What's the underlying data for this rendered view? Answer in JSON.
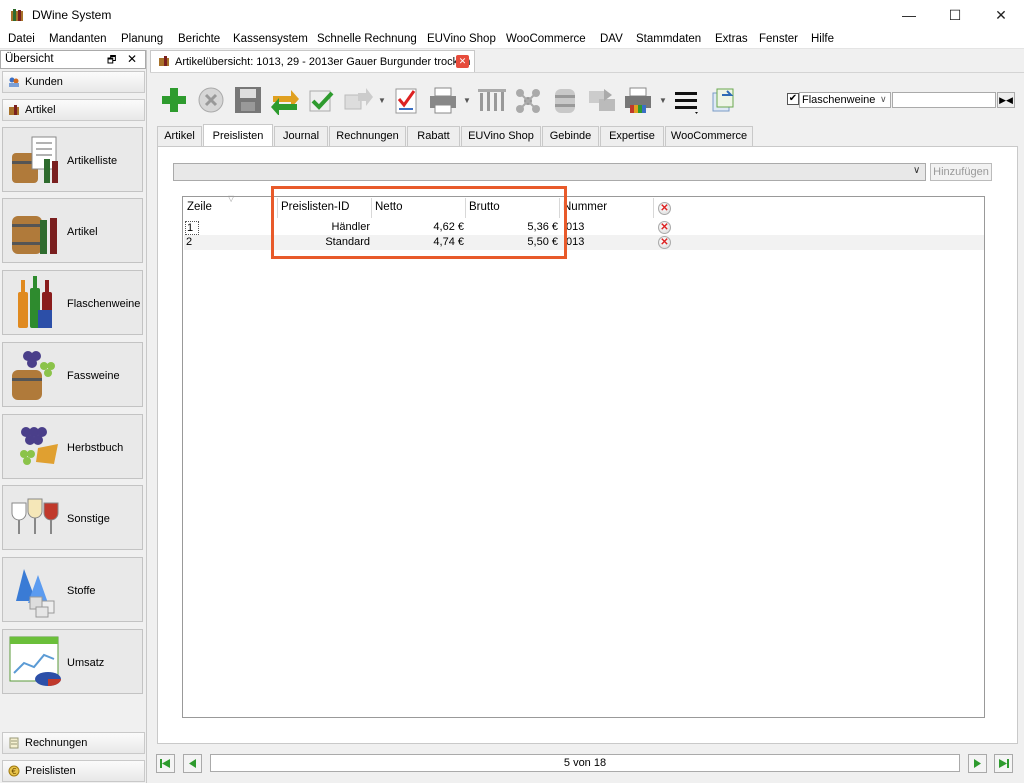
{
  "window": {
    "title": "DWine System",
    "minimize": "—",
    "maximize": "☐",
    "close": "✕"
  },
  "menu": [
    "Datei",
    "Mandanten",
    "Planung",
    "Berichte",
    "Kassensystem",
    "Schnelle Rechnung",
    "EUVino Shop",
    "WooCommerce",
    "DAV",
    "Stammdaten",
    "Extras",
    "Fenster",
    "Hilfe"
  ],
  "sidebar": {
    "title": "Übersicht",
    "pin": "🗗",
    "close": "✕",
    "top_items": [
      "Kunden",
      "Artikel"
    ],
    "tiles": [
      "Artikelliste",
      "Artikel",
      "Flaschenweine",
      "Fassweine",
      "Herbstbuch",
      "Sonstige",
      "Stoffe",
      "Umsatz"
    ],
    "bottom_items": [
      "Rechnungen",
      "Preislisten"
    ]
  },
  "doc_tab": {
    "label": "Artikelübersicht: 1013, 29 - 2013er Gauer Burgunder trocken",
    "close": "✕"
  },
  "toolbar": {
    "icons": [
      "add-icon",
      "cancel-icon",
      "save-icon",
      "refresh-icon",
      "check-icon",
      "forward-icon",
      "validate-icon",
      "print-icon",
      "tools-icon",
      "network-icon",
      "barrel-icon",
      "transfer-icon",
      "print-color-icon",
      "menu-icon",
      "export-icon"
    ],
    "filter_checked": "✔",
    "filter_value": "Flaschenweine",
    "filter_chevron": "∨",
    "search_value": "",
    "search_button": "▶◀"
  },
  "tabs": [
    "Artikel",
    "Preislisten",
    "Journal",
    "Rechnungen",
    "Rabatt",
    "EUVino Shop",
    "Gebinde",
    "Expertise",
    "WooCommerce"
  ],
  "active_tab": "Preislisten",
  "combo": {
    "value": "",
    "chevron": "∨"
  },
  "add_button": "Hinzufügen",
  "table": {
    "sort_indicator": "▽",
    "columns": [
      "Zeile",
      "Preislisten-ID",
      "Netto",
      "Brutto",
      "Nummer"
    ],
    "delete_symbol": "✕",
    "rows": [
      {
        "zeile": "1",
        "id": "Händler",
        "netto": "4,62 €",
        "brutto": "5,36 €",
        "nummer": "013"
      },
      {
        "zeile": "2",
        "id": "Standard",
        "netto": "4,74 €",
        "brutto": "5,50 €",
        "nummer": "013"
      }
    ]
  },
  "pager": {
    "status": "5 von 18"
  },
  "colors": {
    "highlight": "#e85a2a",
    "accent_green": "#2e9b2e",
    "delete_red": "#d22222"
  }
}
